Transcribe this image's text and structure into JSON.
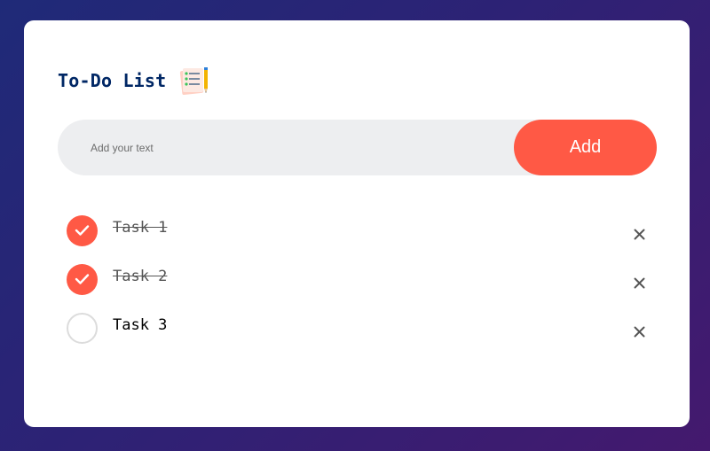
{
  "app": {
    "title": "To-Do List",
    "title_icon": "notebook-pencil-icon"
  },
  "input": {
    "placeholder": "Add your text",
    "value": ""
  },
  "add_button": {
    "label": "Add"
  },
  "colors": {
    "accent": "#ff5945",
    "title": "#002765",
    "background_gradient": [
      "#1f2a78",
      "#44196e"
    ]
  },
  "tasks": [
    {
      "label": "Task 1",
      "checked": true
    },
    {
      "label": "Task 2",
      "checked": true
    },
    {
      "label": "Task 3",
      "checked": false
    }
  ]
}
